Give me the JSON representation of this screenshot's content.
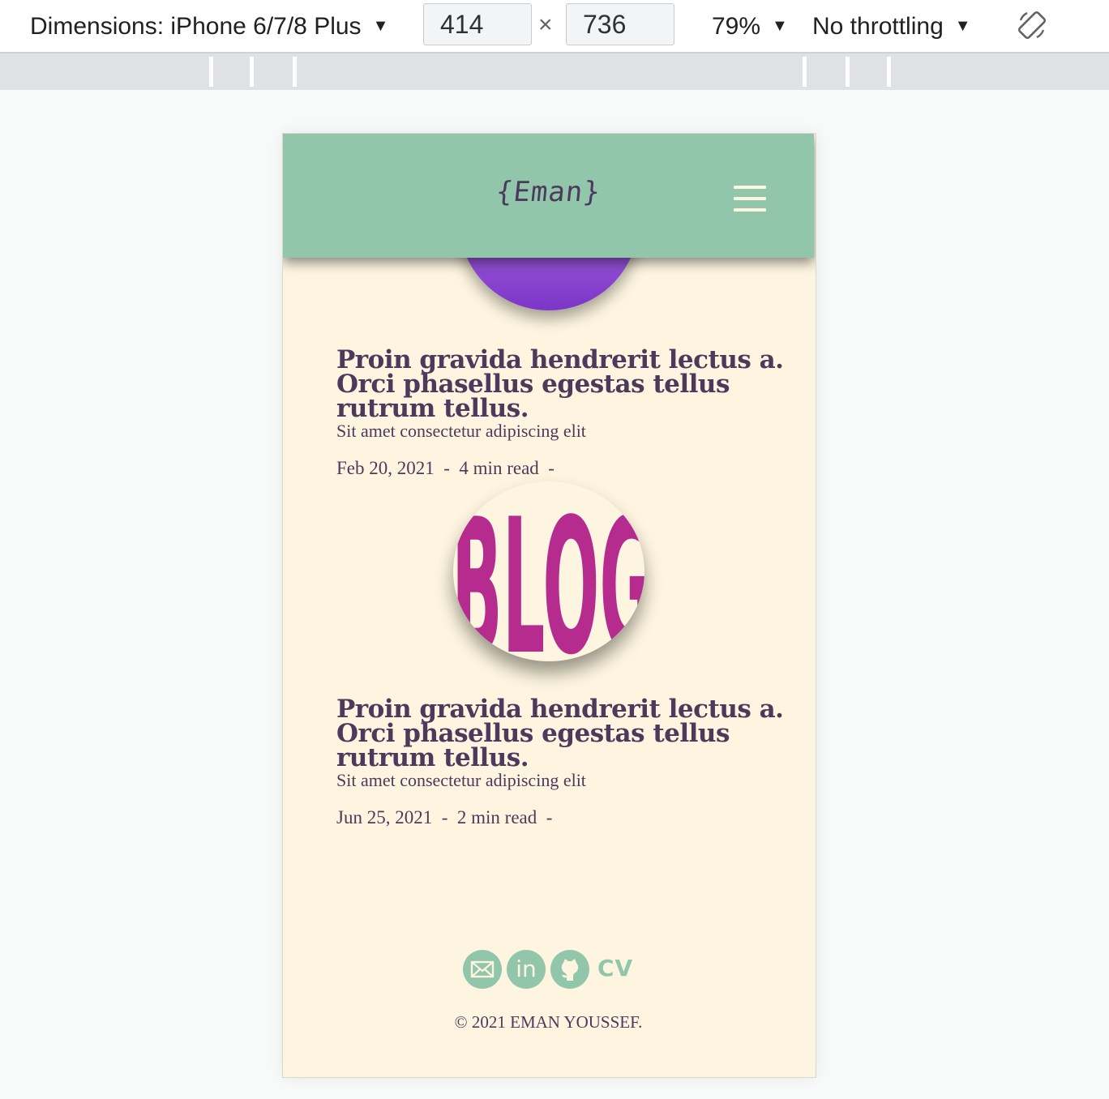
{
  "devtools": {
    "dimensions_label": "Dimensions: iPhone 6/7/8 Plus",
    "width": "414",
    "times": "×",
    "height": "736",
    "zoom": "79%",
    "throttling": "No throttling",
    "caret": "▼",
    "rotate_icon": "rotate-icon"
  },
  "header": {
    "logo": "{Eman}",
    "menu_icon": "hamburger-menu-icon",
    "background": "#91c6ab"
  },
  "posts": [
    {
      "title": "Proin gravida hendrerit lectus a. Orci phasellus egestas tellus rutrum tellus.",
      "subtitle": "Sit amet consectetur adipiscing elit",
      "date": "Feb 20, 2021",
      "read_time": "4 min read",
      "sep": "-"
    },
    {
      "title": "Proin gravida hendrerit lectus a. Orci phasellus egestas tellus rutrum tellus.",
      "subtitle": "Sit amet consectetur adipiscing elit",
      "date": "Jun 25, 2021",
      "read_time": "2 min read",
      "sep": "-"
    }
  ],
  "blog_image": {
    "text": "BLOG",
    "color": "#b52c8e"
  },
  "footer": {
    "social_icons": [
      "mail-icon",
      "linkedin-icon",
      "github-icon"
    ],
    "linkedin_text": "in",
    "cv_label": "CV",
    "copyright": "© 2021 EMAN YOUSSEF."
  },
  "colors": {
    "page_bg": "#fdf5df",
    "text": "#4b3a5c",
    "accent": "#91c6ab"
  }
}
